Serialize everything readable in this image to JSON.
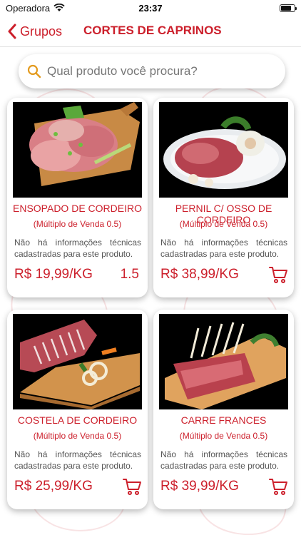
{
  "status_bar": {
    "carrier": "Operadora",
    "time": "23:37"
  },
  "nav": {
    "back_label": "Grupos",
    "title": "CORTES DE CAPRINOS"
  },
  "search": {
    "placeholder": "Qual produto você procura?"
  },
  "products": [
    {
      "name": "ENSOPADO DE CORDEIRO",
      "multiple": "(Múltiplo de Venda 0.5)",
      "description": "Não há informações técnicas cadastradas para este produto.",
      "price": "R$ 19,99/KG",
      "quantity": "1.5"
    },
    {
      "name": "PERNIL C/ OSSO DE CORDEIRO",
      "multiple": "(Múltiplo de Venda 0.5)",
      "description": "Não há informações técnicas cadastradas para este produto.",
      "price": "R$ 38,99/KG",
      "quantity": ""
    },
    {
      "name": "COSTELA DE CORDEIRO",
      "multiple": "(Múltiplo de Venda 0.5)",
      "description": "Não há informações técnicas cadastradas para este produto.",
      "price": "R$ 25,99/KG",
      "quantity": ""
    },
    {
      "name": "CARRE FRANCES",
      "multiple": "(Múltiplo de Venda 0.5)",
      "description": "Não há informações técnicas cadastradas para este produto.",
      "price": "R$ 39,99/KG",
      "quantity": ""
    }
  ],
  "colors": {
    "accent": "#cc1f2b",
    "photo_background": "#000000"
  },
  "icons": {
    "back": "chevron-left-icon",
    "search": "search-icon",
    "cart": "cart-icon"
  }
}
